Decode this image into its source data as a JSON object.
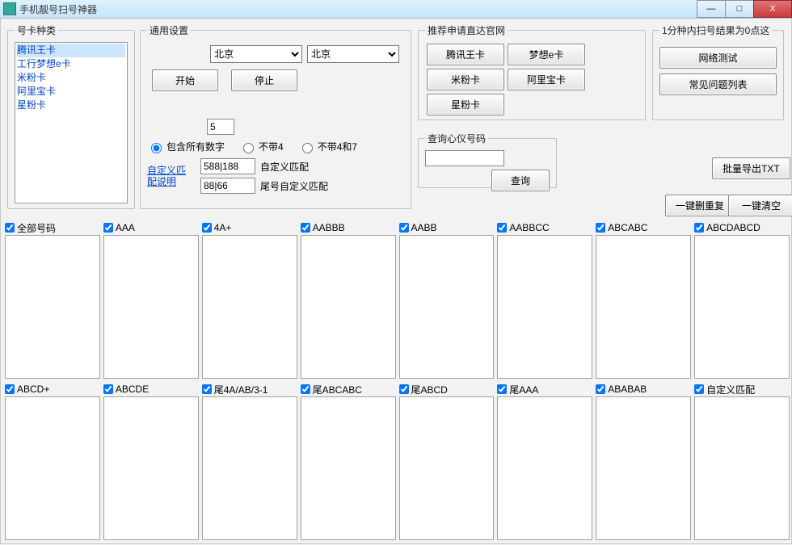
{
  "window": {
    "title": "手机靓号扫号神器",
    "min_icon": "—",
    "max_icon": "□",
    "close_icon": "X"
  },
  "cardtypes": {
    "legend": "号卡种类",
    "items": [
      "腾讯王卡",
      "工行梦想e卡",
      "米粉卡",
      "阿里宝卡",
      "星粉卡"
    ]
  },
  "general": {
    "legend": "通用设置",
    "province": "北京",
    "city": "北京",
    "start": "开始",
    "stop": "停止",
    "count_value": "5",
    "radio_all": "包含所有数字",
    "radio_no4": "不带4",
    "radio_no47": "不带4和7",
    "custom_match_link1": "自定义匹",
    "custom_match_link2": "配说明",
    "custom_match1_val": "588|188",
    "custom_match1_label": "自定义匹配",
    "custom_match2_val": "88|66",
    "custom_match2_label": "尾号自定义匹配"
  },
  "recommend": {
    "legend": "推荐申请直达官网",
    "btns": [
      "腾讯王卡",
      "梦想e卡",
      "米粉卡",
      "阿里宝卡",
      "星粉卡"
    ]
  },
  "onemin": {
    "legend": "1分种内扫号结果为0点这",
    "btn_net": "网络测试",
    "btn_faq": "常见问题列表"
  },
  "query": {
    "legend": "查询心仪号码",
    "value": "",
    "btn": "查询"
  },
  "export": {
    "label": "批量导出TXT"
  },
  "dedupe": {
    "label": "一键删重复"
  },
  "clearall": {
    "label": "一键清空"
  },
  "grid_row1": [
    {
      "label": "全部号码"
    },
    {
      "label": "AAA"
    },
    {
      "label": "4A+"
    },
    {
      "label": "AABBB"
    },
    {
      "label": "AABB"
    },
    {
      "label": "AABBCC"
    },
    {
      "label": "ABCABC"
    },
    {
      "label": "ABCDABCD"
    }
  ],
  "grid_row2": [
    {
      "label": "ABCD+"
    },
    {
      "label": "ABCDE"
    },
    {
      "label": "尾4A/AB/3-1"
    },
    {
      "label": "尾ABCABC"
    },
    {
      "label": "尾ABCD"
    },
    {
      "label": "尾AAA"
    },
    {
      "label": "ABABAB"
    },
    {
      "label": "自定义匹配"
    }
  ]
}
